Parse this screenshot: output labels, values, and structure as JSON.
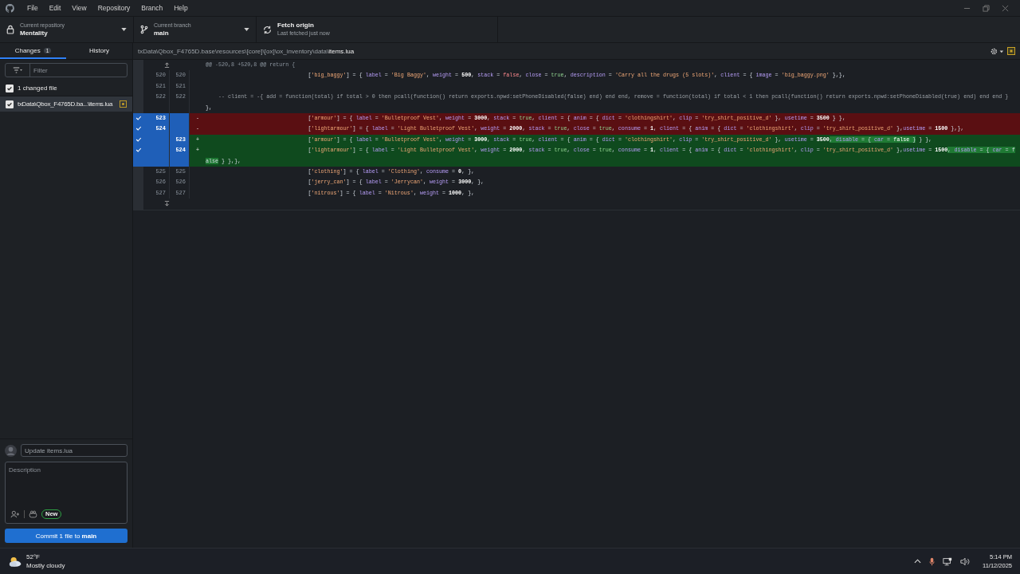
{
  "menu": [
    "File",
    "Edit",
    "View",
    "Repository",
    "Branch",
    "Help"
  ],
  "toolbar": {
    "repository": {
      "caption": "Current repository",
      "value": "Mentality"
    },
    "branch": {
      "caption": "Current branch",
      "value": "main"
    },
    "fetch": {
      "title": "Fetch origin",
      "subtitle": "Last fetched just now"
    }
  },
  "tabs": [
    {
      "label": "Changes",
      "count": "1",
      "selected": true
    },
    {
      "label": "History",
      "selected": false
    }
  ],
  "filter": {
    "placeholder": "Filter"
  },
  "changed_files": {
    "label": "1 changed file",
    "checked": true,
    "files": [
      {
        "name": "txData\\Qbox_F4765D.ba...\\items.lua",
        "checked": true,
        "selected": true
      }
    ]
  },
  "path": {
    "dir": "txData\\Qbox_F4765D.base\\resources\\[core]\\[ox]\\ox_inventory\\data\\",
    "file": "items.lua"
  },
  "diff": [
    {
      "kind": "hunk",
      "text": "@@ -520,8 +520,8 @@ return {"
    },
    {
      "kind": "context",
      "old": "520",
      "new": "520",
      "segments": [
        {
          "text": "                                ['big_baggy'] = { label = 'Big Baggy', weight = 500, stack = false, close = true, description = 'Carry all the drugs (5 slots)', client = { image = 'big_baggy.png' },},",
          "highlight": false
        }
      ]
    },
    {
      "kind": "context",
      "old": "521",
      "new": "521"
    },
    {
      "kind": "context",
      "old": "522",
      "new": "522",
      "segments": [
        {
          "text": "    -- client = -{ add = function(total) if total > 0 then pcall(function() return exports.npwd:setPhoneDisabled(false) end) end end, remove = function(total) if total < 1 then pcall(function() return exports.npwd:setPhoneDisabled(true) end) end end }",
          "highlight": false
        }
      ],
      "continuation": [
        {
          "text": "},",
          "highlight": false
        }
      ]
    },
    {
      "kind": "deleted",
      "old": "523",
      "marker": "-",
      "selected": true,
      "segments": [
        {
          "text": "                                ['armour'] = { label = 'Bulletproof Vest', weight = 3000, stack = true, client = { anim = { dict = 'clothingshirt', clip = 'try_shirt_positive_d' }, usetime = 3500 } },",
          "highlight": false
        }
      ]
    },
    {
      "kind": "deleted",
      "old": "524",
      "marker": "-",
      "selected": true,
      "segments": [
        {
          "text": "                                ['lightarmour'] = { label = 'Light Bulletproof Vest', weight = 2000, stack = true, close = true, consume = 1, client = { anim = { dict = 'clothingshirt', clip = 'try_shirt_positive_d' },usetime = 1500 },},",
          "highlight": false
        }
      ]
    },
    {
      "kind": "added",
      "new": "523",
      "marker": "+",
      "selected": true,
      "segments": [
        {
          "text": "                                ['armour'] = { label = 'Bulletproof Vest', weight = 3000, stack = true, client = { anim = { dict = 'clothingshirt', clip = 'try_shirt_positive_d' }, usetime = 3500",
          "highlight": false
        },
        {
          "text": ", disable = { car = false }",
          "highlight": true
        },
        {
          "text": " } },",
          "highlight": false
        }
      ]
    },
    {
      "kind": "added",
      "new": "524",
      "marker": "+",
      "selected": true,
      "segments": [
        {
          "text": "                                ['lightarmour'] = { label = 'Light Bulletproof Vest', weight = 2000, stack = true, close = true, consume = 1, client = { anim = { dict = 'clothingshirt', clip = 'try_shirt_positive_d' },usetime = 1500",
          "highlight": false
        },
        {
          "text": ", disable = { car = f",
          "highlight": true
        }
      ],
      "continuation": [
        {
          "text": "alse",
          "highlight": true
        },
        {
          "text": " } },},",
          "highlight": false
        }
      ]
    },
    {
      "kind": "context",
      "old": "525",
      "new": "525",
      "segments": [
        {
          "text": "                                ['clothing'] = { label = 'Clothing', consume = 0, },",
          "highlight": false
        }
      ]
    },
    {
      "kind": "context",
      "old": "526",
      "new": "526",
      "segments": [
        {
          "text": "                                ['jerry_can'] = { label = 'Jerrycan', weight = 3000, },",
          "highlight": false
        }
      ]
    },
    {
      "kind": "context",
      "old": "527",
      "new": "527",
      "segments": [
        {
          "text": "                                ['nitrous'] = { label = 'Nitrous', weight = 1000, },",
          "highlight": false
        }
      ]
    },
    {
      "kind": "expand"
    }
  ],
  "commit": {
    "summary": {
      "value": "Update items.lua"
    },
    "description": {
      "placeholder": "Description"
    },
    "badge": "New",
    "button": {
      "text": "Commit 1 file to ",
      "branch": "main"
    }
  },
  "taskbar": {
    "weather": {
      "temperature": "52°F",
      "condition": "Mostly cloudy"
    },
    "time": "5:14 PM",
    "date": "11/12/2025"
  }
}
